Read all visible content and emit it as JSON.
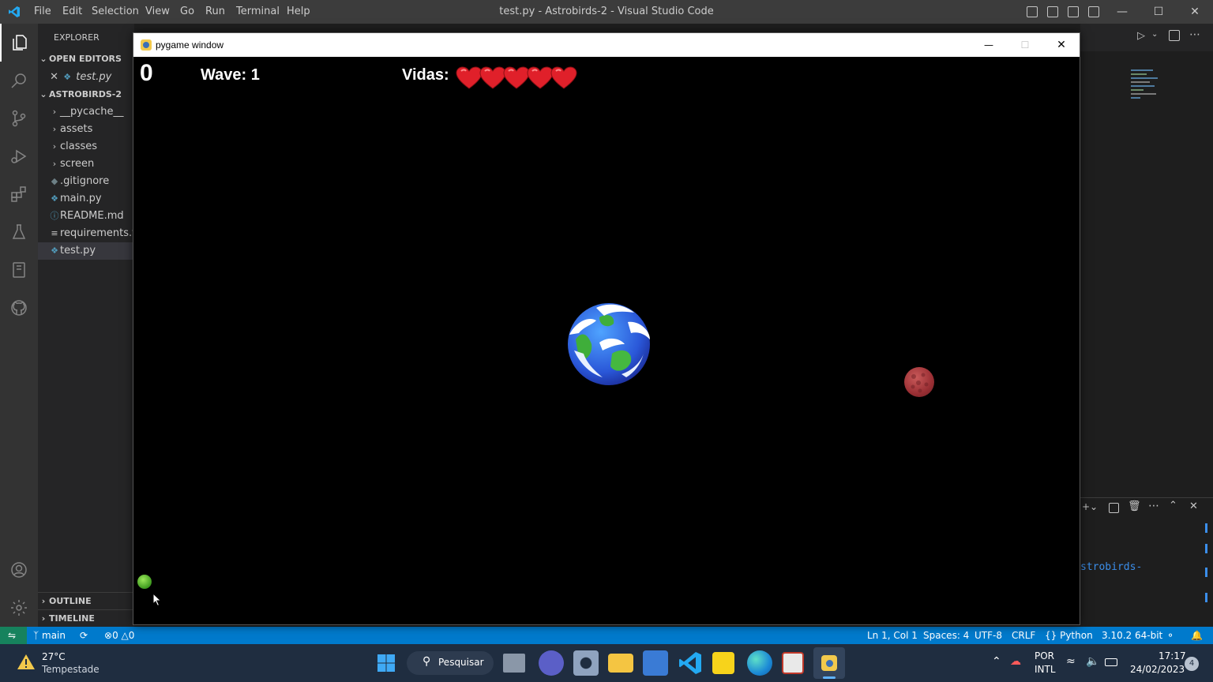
{
  "vscode": {
    "menu": [
      "File",
      "Edit",
      "Selection",
      "View",
      "Go",
      "Run",
      "Terminal",
      "Help"
    ],
    "window_title": "test.py - Astrobirds-2 - Visual Studio Code"
  },
  "sidebar": {
    "title": "EXPLORER",
    "open_editors_label": "OPEN EDITORS",
    "open_editor_file": "test.py",
    "project_label": "ASTROBIRDS-2",
    "folders": [
      "__pycache__",
      "assets",
      "classes",
      "screen"
    ],
    "files": [
      ".gitignore",
      "main.py",
      "README.md",
      "requirements.txt",
      "test.py"
    ],
    "outline_label": "OUTLINE",
    "timeline_label": "TIMELINE"
  },
  "terminal_fragment": "strobirds-",
  "statusbar": {
    "branch": "main",
    "errors": "0",
    "warnings": "0",
    "cursor": "Ln 1, Col 1",
    "spaces": "Spaces: 4",
    "encoding": "UTF-8",
    "eol": "CRLF",
    "language": "Python",
    "interpreter": "3.10.2 64-bit"
  },
  "pygame": {
    "window_title": "pygame window",
    "score": "0",
    "wave_label": "Wave: 1",
    "lives_label": "Vidas:",
    "lives": 5
  },
  "taskbar": {
    "temperature": "27°C",
    "weather": "Tempestade",
    "search_label": "Pesquisar",
    "lang_line1": "POR",
    "lang_line2": "INTL",
    "time": "17:17",
    "date": "24/02/2023",
    "notifications": "4"
  },
  "colors": {
    "accent": "#007acc",
    "titlebar": "#3c3c3c",
    "heart": "#e0202a"
  }
}
